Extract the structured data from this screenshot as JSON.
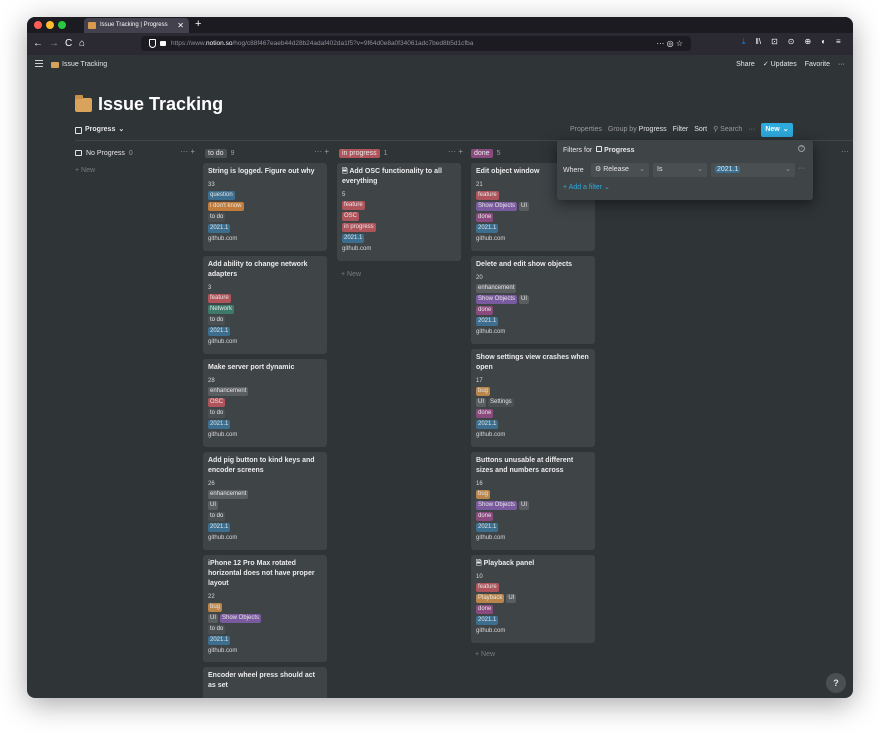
{
  "browser": {
    "tab_title": "Issue Tracking | Progress",
    "tab_close": "✕",
    "new_tab": "+",
    "url_prefix": "https://www.",
    "url_domain": "notion.so",
    "url_rest": "/hog/c88f467eaeb44d28b24adaf402da1f5?v=9f64d0e8a0f34061adc7bed8b5d1cfba",
    "url_actions": "··· ◎ ☆",
    "back": "←",
    "forward": "→",
    "reload": "C",
    "home": "⌂",
    "toolbar_icons": [
      "⤓",
      "‖\\",
      "⊡",
      "⊙",
      "⊕",
      "◐",
      "≡"
    ]
  },
  "topbar": {
    "breadcrumb": "Issue Tracking",
    "share": "Share",
    "updates": "✓ Updates",
    "favorite": "Favorite",
    "more": "···"
  },
  "page": {
    "title": "Issue Tracking"
  },
  "viewbar": {
    "view_name": "Progress",
    "view_chevron": "⌄",
    "properties": "Properties",
    "group_by_label": "Group by",
    "group_by_value": "Progress",
    "filter": "Filter",
    "sort": "Sort",
    "search": "⚲ Search",
    "more": "···",
    "new_label": "New",
    "new_chevron": "⌄"
  },
  "columns": [
    {
      "name": "No Progress",
      "count": "0",
      "color": "",
      "actions": "··· +"
    },
    {
      "name": "to do",
      "count": "9",
      "color": "#4a4f52",
      "actions": "··· +"
    },
    {
      "name": "in progress",
      "count": "1",
      "color": "#b0545b",
      "actions": "··· +"
    },
    {
      "name": "done",
      "count": "5",
      "color": "#8a4a7d",
      "actions": "··· +"
    }
  ],
  "add_new": "+ New",
  "cards": {
    "c1": {
      "title": "String is logged. Figure out why",
      "num": "33",
      "tags": [
        "question",
        "i don't know"
      ],
      "status": "to do",
      "release": "2021.1",
      "src": "github.com"
    },
    "c2": {
      "title": "Add ability to change network adapters",
      "num": "3",
      "tags": [
        "feature",
        "Network"
      ],
      "status": "to do",
      "release": "2021.1",
      "src": "github.com"
    },
    "c3": {
      "title": "Make server port dynamic",
      "num": "28",
      "tags": [
        "enhancement",
        "OSC"
      ],
      "status": "to do",
      "release": "2021.1",
      "src": "github.com"
    },
    "c4": {
      "title": "Add pig button to kind keys and encoder screens",
      "num": "26",
      "tags": [
        "enhancement",
        "UI"
      ],
      "status": "to do",
      "release": "2021.1",
      "src": "github.com"
    },
    "c5": {
      "title": "iPhone 12 Pro Max rotated horizontal does not have proper layout",
      "num": "22",
      "tags": [
        "bug",
        "UI",
        "Show Objects"
      ],
      "status": "to do",
      "release": "2021.1",
      "src": "github.com"
    },
    "c6": {
      "title": "Encoder wheel press should act as set"
    },
    "p1": {
      "title": "Add OSC functionality to all everything",
      "num": "5",
      "tags": [
        "feature",
        "OSC"
      ],
      "status": "in progress",
      "release": "2021.1",
      "src": "github.com"
    },
    "d1": {
      "title": "Edit object window",
      "num": "21",
      "tags": [
        "feature",
        "Show Objects",
        "UI"
      ],
      "status": "done",
      "release": "2021.1",
      "src": "github.com"
    },
    "d2": {
      "title": "Delete and edit show objects",
      "num": "20",
      "tags": [
        "enhancement",
        "Show Objects",
        "UI"
      ],
      "status": "done",
      "release": "2021.1",
      "src": "github.com"
    },
    "d3": {
      "title": "Show settings view crashes when open",
      "num": "17",
      "tags": [
        "bug",
        "UI",
        "Settings"
      ],
      "status": "done",
      "release": "2021.1",
      "src": "github.com"
    },
    "d4": {
      "title": "Buttons unusable at different sizes and numbers across",
      "num": "16",
      "tags": [
        "bug",
        "Show Objects",
        "UI"
      ],
      "status": "done",
      "release": "2021.1",
      "src": "github.com"
    },
    "d5": {
      "title": "Playback panel",
      "num": "10",
      "tags": [
        "feature",
        "Playback",
        "UI"
      ],
      "status": "done",
      "release": "2021.1",
      "src": "github.com"
    }
  },
  "filter_panel": {
    "title_prefix": "Filters for",
    "title_view": "Progress",
    "help": "?",
    "where": "Where",
    "property": "⚙ Release",
    "operator": "Is",
    "value": "2021.1",
    "chevron": "⌄",
    "more": "···",
    "add_filter": "+ Add a filter ⌄"
  },
  "far_more": "···",
  "help_button": "?",
  "colors": {
    "accent": "#2eaadc",
    "tag_question": "#3b6e8f",
    "tag_idk": "#c17b3a",
    "tag_feature": "#b0545b",
    "tag_enhancement": "#5a5e61",
    "tag_network": "#3d7a6a",
    "tag_osc": "#b0545b",
    "tag_bug": "#b9854a",
    "tag_ui": "#5a5e61",
    "tag_showobjects": "#7a5a9e",
    "tag_settings": "#4a4f52",
    "tag_playback": "#b9854a",
    "tag_release": "#3b6e8f",
    "tag_status_todo": "#4a4f52",
    "tag_status_done": "#8a4a7d",
    "tag_status_progress": "#b0545b"
  }
}
